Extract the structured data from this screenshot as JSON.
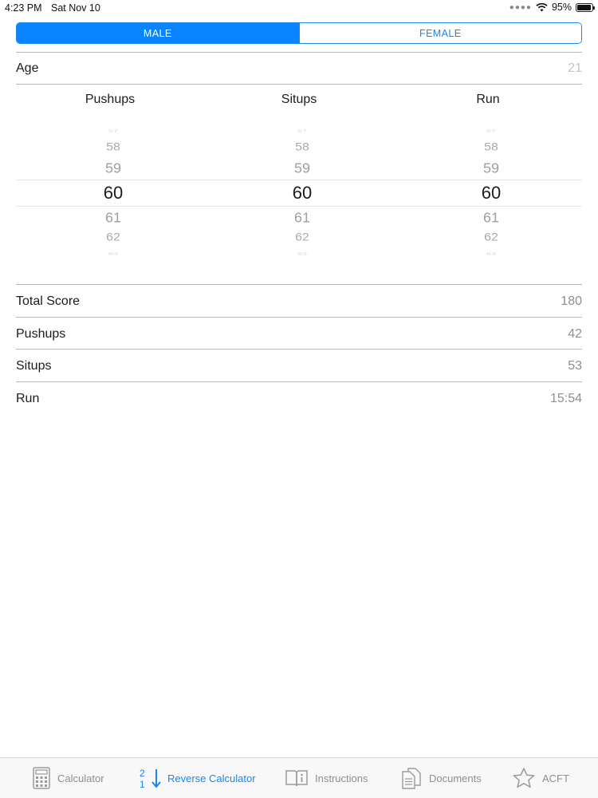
{
  "status_bar": {
    "time": "4:23 PM",
    "date": "Sat Nov 10",
    "battery": "95%",
    "battery_level": 0.95
  },
  "gender": {
    "options": [
      "MALE",
      "FEMALE"
    ],
    "selected": "MALE"
  },
  "age": {
    "label": "Age",
    "value": "21"
  },
  "pickers": [
    {
      "header": "Pushups",
      "values": [
        "57",
        "58",
        "59",
        "60",
        "61",
        "62",
        "63"
      ],
      "selected": "60"
    },
    {
      "header": "Situps",
      "values": [
        "57",
        "58",
        "59",
        "60",
        "61",
        "62",
        "63"
      ],
      "selected": "60"
    },
    {
      "header": "Run",
      "values": [
        "57",
        "58",
        "59",
        "60",
        "61",
        "62",
        "63"
      ],
      "selected": "60"
    }
  ],
  "results": [
    {
      "label": "Total Score",
      "value": "180"
    },
    {
      "label": "Pushups",
      "value": "42"
    },
    {
      "label": "Situps",
      "value": "53"
    },
    {
      "label": "Run",
      "value": "15:54"
    }
  ],
  "tabs": [
    {
      "label": "Calculator",
      "icon": "calculator-icon",
      "active": false
    },
    {
      "label": "Reverse Calculator",
      "icon": "sort-descending-icon",
      "active": true
    },
    {
      "label": "Instructions",
      "icon": "book-icon",
      "active": false
    },
    {
      "label": "Documents",
      "icon": "document-icon",
      "active": false
    },
    {
      "label": "ACFT",
      "icon": "star-icon",
      "active": false
    }
  ],
  "colors": {
    "accent": "#0a84ff",
    "secondary_text": "#8e8e93",
    "divider": "#b8b8b8"
  }
}
